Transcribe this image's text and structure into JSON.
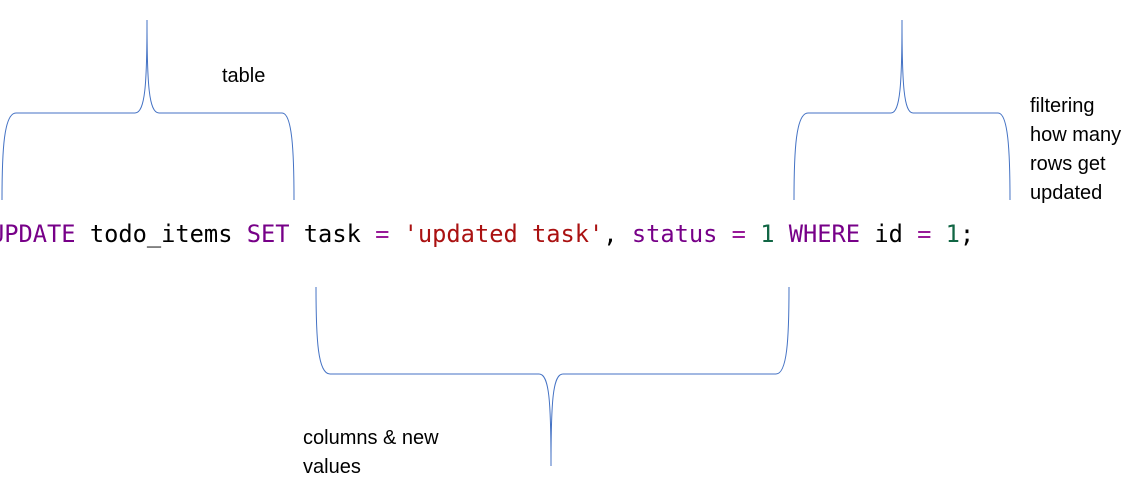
{
  "annotations": {
    "table": [
      "table"
    ],
    "filter": [
      "filtering",
      "how many",
      "rows get",
      "updated"
    ],
    "columns": [
      "columns & new",
      "values"
    ]
  },
  "code": {
    "tokens": [
      {
        "text": "UPDATE",
        "type": "keyword"
      },
      {
        "text": " ",
        "type": "space"
      },
      {
        "text": "todo_items",
        "type": "ident"
      },
      {
        "text": " ",
        "type": "space"
      },
      {
        "text": "SET",
        "type": "keyword"
      },
      {
        "text": " ",
        "type": "space"
      },
      {
        "text": "task",
        "type": "ident"
      },
      {
        "text": " ",
        "type": "space"
      },
      {
        "text": "=",
        "type": "operator"
      },
      {
        "text": " ",
        "type": "space"
      },
      {
        "text": "'updated task'",
        "type": "string"
      },
      {
        "text": ", ",
        "type": "punct"
      },
      {
        "text": "status",
        "type": "keyword"
      },
      {
        "text": " ",
        "type": "space"
      },
      {
        "text": "=",
        "type": "operator"
      },
      {
        "text": " ",
        "type": "space"
      },
      {
        "text": "1",
        "type": "number"
      },
      {
        "text": " ",
        "type": "space"
      },
      {
        "text": "WHERE",
        "type": "keyword"
      },
      {
        "text": " ",
        "type": "space"
      },
      {
        "text": "id",
        "type": "ident"
      },
      {
        "text": " ",
        "type": "space"
      },
      {
        "text": "=",
        "type": "operator"
      },
      {
        "text": " ",
        "type": "space"
      },
      {
        "text": "1",
        "type": "number"
      },
      {
        "text": ";",
        "type": "punct"
      }
    ]
  },
  "colors": {
    "brace": "#4472c4",
    "keyword": "#770088",
    "operator": "#981a98",
    "string": "#aa1111",
    "number": "#116644",
    "text": "#000000"
  }
}
